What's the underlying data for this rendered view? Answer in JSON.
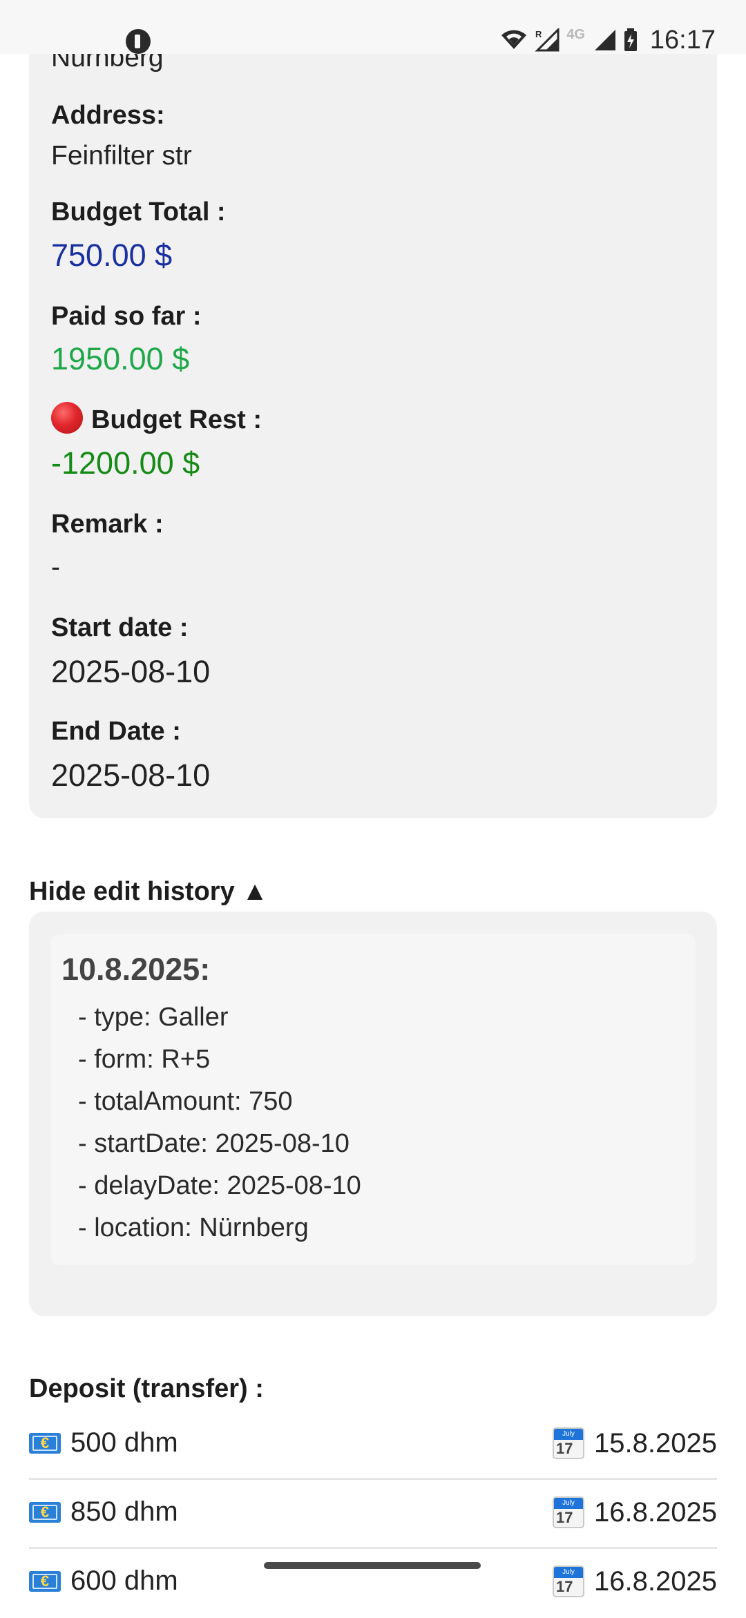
{
  "status_bar": {
    "time": "16:17",
    "network": "4G",
    "roaming": "R",
    "icons": [
      "app-notification-icon",
      "wifi-icon",
      "signal-roaming-icon",
      "signal-icon",
      "battery-charging-icon"
    ]
  },
  "details": {
    "location_value": "Nürnberg",
    "address_label": "Address:",
    "address_value": "Feinfilter str",
    "budget_total_label": "Budget Total :",
    "budget_total_value": "750.00 $",
    "paid_label": "Paid so far :",
    "paid_value": "1950.00 $",
    "rest_label": "Budget Rest :",
    "rest_value": "-1200.00 $",
    "remark_label": "Remark :",
    "remark_value": "-",
    "start_label": "Start date :",
    "start_value": "2025-08-10",
    "end_label": "End Date :",
    "end_value": "2025-08-10"
  },
  "colors": {
    "budget_total": "#1a2fa0",
    "paid": "#1fa84a",
    "rest": "#158a15",
    "rest_indicator": "#e0262c"
  },
  "history": {
    "toggle_label": "Hide edit history ▲",
    "entries": [
      {
        "date": "10.8.2025:",
        "lines": [
          "- type: Galler",
          "- form: R+5",
          "- totalAmount: 750",
          "- startDate: 2025-08-10",
          "- delayDate: 2025-08-10",
          "- location: Nürnberg"
        ]
      }
    ]
  },
  "deposits": {
    "title": "Deposit (transfer) :",
    "items": [
      {
        "amount": "500 dhm",
        "date": "15.8.2025"
      },
      {
        "amount": "850 dhm",
        "date": "16.8.2025"
      },
      {
        "amount": "600 dhm",
        "date": "16.8.2025"
      }
    ]
  }
}
